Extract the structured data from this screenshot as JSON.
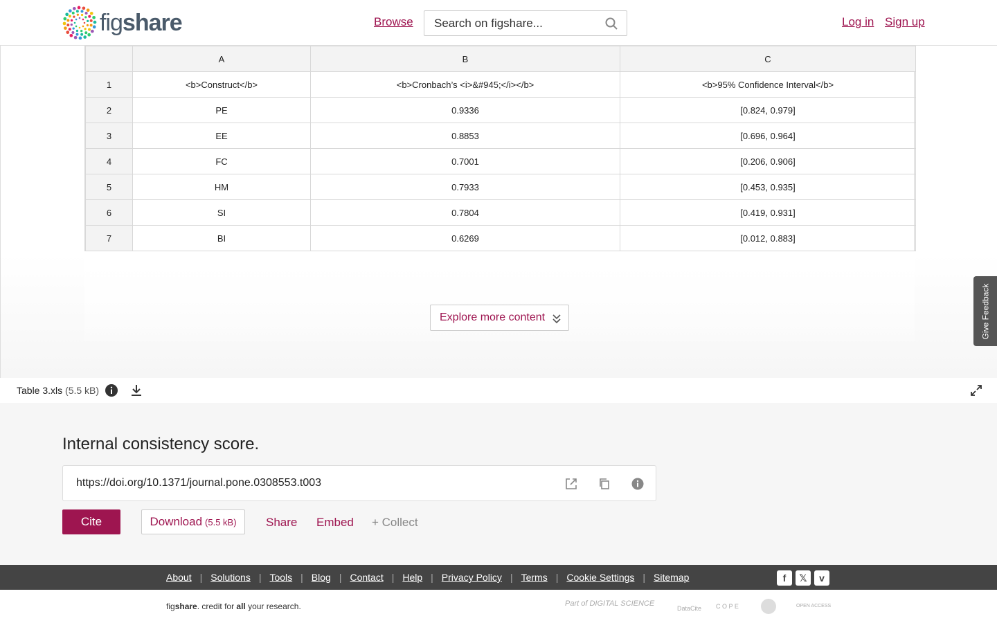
{
  "header": {
    "logo_text_light": "fig",
    "logo_text_bold": "share",
    "browse": "Browse",
    "search_placeholder": "Search on figshare...",
    "login": "Log in",
    "signup": "Sign up"
  },
  "sheet": {
    "columns": [
      "A",
      "B",
      "C"
    ],
    "rows": [
      {
        "n": "1",
        "cells": [
          "<b>Construct</b>",
          "<b>Cronbach’s <i>&#945;</i></b>",
          "<b>95% Confidence Interval</b>"
        ]
      },
      {
        "n": "2",
        "cells": [
          "PE",
          "0.9336",
          "[0.824, 0.979]"
        ]
      },
      {
        "n": "3",
        "cells": [
          "EE",
          "0.8853",
          "[0.696, 0.964]"
        ]
      },
      {
        "n": "4",
        "cells": [
          "FC",
          "0.7001",
          "[0.206, 0.906]"
        ]
      },
      {
        "n": "5",
        "cells": [
          "HM",
          "0.7933",
          "[0.453, 0.935]"
        ]
      },
      {
        "n": "6",
        "cells": [
          "SI",
          "0.7804",
          "[0.419, 0.931]"
        ]
      },
      {
        "n": "7",
        "cells": [
          "BI",
          "0.6269",
          "[0.012, 0.883]"
        ]
      }
    ]
  },
  "explore_label": "Explore more content",
  "feedback_label": "Give Feedback",
  "file": {
    "name": "Table 3.xls",
    "size": "(5.5 kB)"
  },
  "details": {
    "title": "Internal consistency score.",
    "doi": "https://doi.org/10.1371/journal.pone.0308553.t003",
    "cite": "Cite",
    "download": "Download",
    "download_size": "(5.5 kB)",
    "share": "Share",
    "embed": "Embed",
    "collect": "+ Collect"
  },
  "footer": {
    "links": [
      "About",
      "Solutions",
      "Tools",
      "Blog",
      "Contact",
      "Help",
      "Privacy Policy",
      "Terms",
      "Cookie Settings",
      "Sitemap"
    ],
    "tagline_pre": "fig",
    "tagline_bold": "share",
    "tagline_mid": ". credit for ",
    "tagline_all": "all",
    "tagline_end": " your research.",
    "partners": [
      "Part of DIGITAL SCIENCE",
      "DataCite",
      "C O P E",
      "OPEN ACCESS"
    ]
  },
  "colors": {
    "accent": "#9e1550",
    "footer_bg": "#444444"
  }
}
